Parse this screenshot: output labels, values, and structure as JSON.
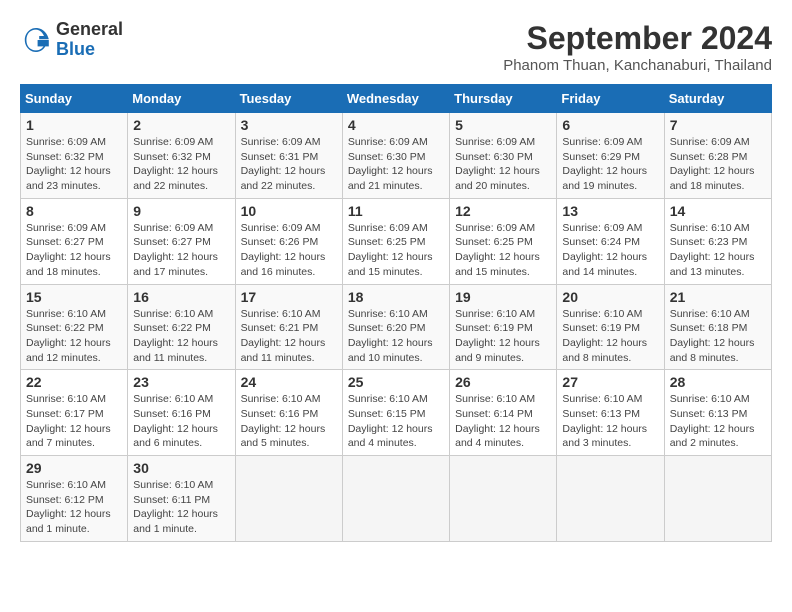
{
  "header": {
    "logo_general": "General",
    "logo_blue": "Blue",
    "month_year": "September 2024",
    "location": "Phanom Thuan, Kanchanaburi, Thailand"
  },
  "weekdays": [
    "Sunday",
    "Monday",
    "Tuesday",
    "Wednesday",
    "Thursday",
    "Friday",
    "Saturday"
  ],
  "weeks": [
    [
      {
        "day": "1",
        "sunrise": "6:09 AM",
        "sunset": "6:32 PM",
        "daylight": "12 hours and 23 minutes."
      },
      {
        "day": "2",
        "sunrise": "6:09 AM",
        "sunset": "6:32 PM",
        "daylight": "12 hours and 22 minutes."
      },
      {
        "day": "3",
        "sunrise": "6:09 AM",
        "sunset": "6:31 PM",
        "daylight": "12 hours and 22 minutes."
      },
      {
        "day": "4",
        "sunrise": "6:09 AM",
        "sunset": "6:30 PM",
        "daylight": "12 hours and 21 minutes."
      },
      {
        "day": "5",
        "sunrise": "6:09 AM",
        "sunset": "6:30 PM",
        "daylight": "12 hours and 20 minutes."
      },
      {
        "day": "6",
        "sunrise": "6:09 AM",
        "sunset": "6:29 PM",
        "daylight": "12 hours and 19 minutes."
      },
      {
        "day": "7",
        "sunrise": "6:09 AM",
        "sunset": "6:28 PM",
        "daylight": "12 hours and 18 minutes."
      }
    ],
    [
      {
        "day": "8",
        "sunrise": "6:09 AM",
        "sunset": "6:27 PM",
        "daylight": "12 hours and 18 minutes."
      },
      {
        "day": "9",
        "sunrise": "6:09 AM",
        "sunset": "6:27 PM",
        "daylight": "12 hours and 17 minutes."
      },
      {
        "day": "10",
        "sunrise": "6:09 AM",
        "sunset": "6:26 PM",
        "daylight": "12 hours and 16 minutes."
      },
      {
        "day": "11",
        "sunrise": "6:09 AM",
        "sunset": "6:25 PM",
        "daylight": "12 hours and 15 minutes."
      },
      {
        "day": "12",
        "sunrise": "6:09 AM",
        "sunset": "6:25 PM",
        "daylight": "12 hours and 15 minutes."
      },
      {
        "day": "13",
        "sunrise": "6:09 AM",
        "sunset": "6:24 PM",
        "daylight": "12 hours and 14 minutes."
      },
      {
        "day": "14",
        "sunrise": "6:10 AM",
        "sunset": "6:23 PM",
        "daylight": "12 hours and 13 minutes."
      }
    ],
    [
      {
        "day": "15",
        "sunrise": "6:10 AM",
        "sunset": "6:22 PM",
        "daylight": "12 hours and 12 minutes."
      },
      {
        "day": "16",
        "sunrise": "6:10 AM",
        "sunset": "6:22 PM",
        "daylight": "12 hours and 11 minutes."
      },
      {
        "day": "17",
        "sunrise": "6:10 AM",
        "sunset": "6:21 PM",
        "daylight": "12 hours and 11 minutes."
      },
      {
        "day": "18",
        "sunrise": "6:10 AM",
        "sunset": "6:20 PM",
        "daylight": "12 hours and 10 minutes."
      },
      {
        "day": "19",
        "sunrise": "6:10 AM",
        "sunset": "6:19 PM",
        "daylight": "12 hours and 9 minutes."
      },
      {
        "day": "20",
        "sunrise": "6:10 AM",
        "sunset": "6:19 PM",
        "daylight": "12 hours and 8 minutes."
      },
      {
        "day": "21",
        "sunrise": "6:10 AM",
        "sunset": "6:18 PM",
        "daylight": "12 hours and 8 minutes."
      }
    ],
    [
      {
        "day": "22",
        "sunrise": "6:10 AM",
        "sunset": "6:17 PM",
        "daylight": "12 hours and 7 minutes."
      },
      {
        "day": "23",
        "sunrise": "6:10 AM",
        "sunset": "6:16 PM",
        "daylight": "12 hours and 6 minutes."
      },
      {
        "day": "24",
        "sunrise": "6:10 AM",
        "sunset": "6:16 PM",
        "daylight": "12 hours and 5 minutes."
      },
      {
        "day": "25",
        "sunrise": "6:10 AM",
        "sunset": "6:15 PM",
        "daylight": "12 hours and 4 minutes."
      },
      {
        "day": "26",
        "sunrise": "6:10 AM",
        "sunset": "6:14 PM",
        "daylight": "12 hours and 4 minutes."
      },
      {
        "day": "27",
        "sunrise": "6:10 AM",
        "sunset": "6:13 PM",
        "daylight": "12 hours and 3 minutes."
      },
      {
        "day": "28",
        "sunrise": "6:10 AM",
        "sunset": "6:13 PM",
        "daylight": "12 hours and 2 minutes."
      }
    ],
    [
      {
        "day": "29",
        "sunrise": "6:10 AM",
        "sunset": "6:12 PM",
        "daylight": "12 hours and 1 minute."
      },
      {
        "day": "30",
        "sunrise": "6:10 AM",
        "sunset": "6:11 PM",
        "daylight": "12 hours and 1 minute."
      },
      null,
      null,
      null,
      null,
      null
    ]
  ]
}
